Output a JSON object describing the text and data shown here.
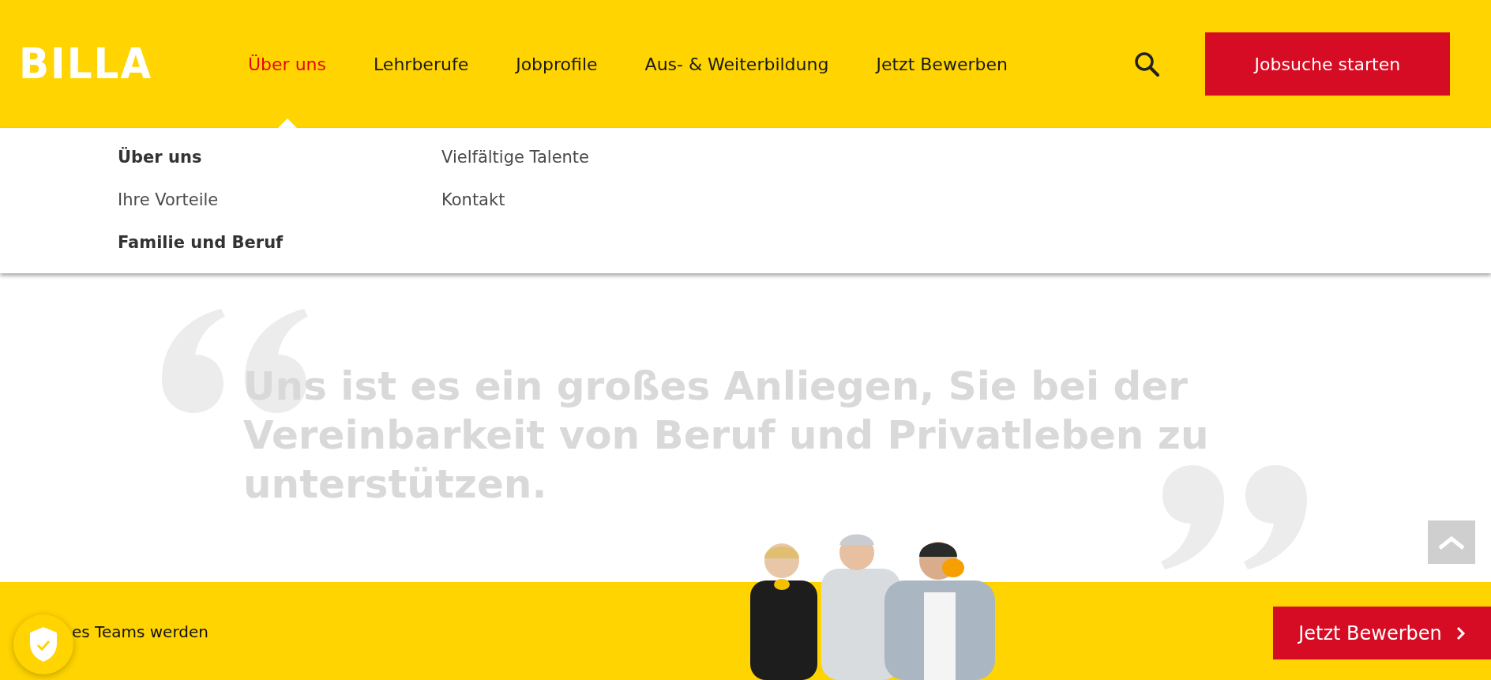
{
  "header": {
    "logo": "BILLA",
    "nav": [
      {
        "label": "Über uns",
        "selected": true
      },
      {
        "label": "Lehrberufe",
        "selected": false
      },
      {
        "label": "Jobprofile",
        "selected": false
      },
      {
        "label": "Aus- & Weiterbildung",
        "selected": false
      },
      {
        "label": "Jetzt Bewerben",
        "selected": false
      }
    ],
    "cta": "Jobsuche starten"
  },
  "dropdown": {
    "columns": [
      [
        {
          "label": "Über uns",
          "selected": true
        },
        {
          "label": "Ihre Vorteile",
          "selected": false
        },
        {
          "label": "Familie und Beruf",
          "selected": true
        }
      ],
      [
        {
          "label": "Vielfältige Talente",
          "selected": false
        },
        {
          "label": "Kontakt",
          "selected": false
        }
      ]
    ]
  },
  "quote": "Uns ist es ein großes Anliegen, Sie bei der Vereinbarkeit von Beruf und Privatleben zu unterstützen.",
  "banner": {
    "text": "es Teams werden",
    "button": "Jetzt Bewerben"
  }
}
